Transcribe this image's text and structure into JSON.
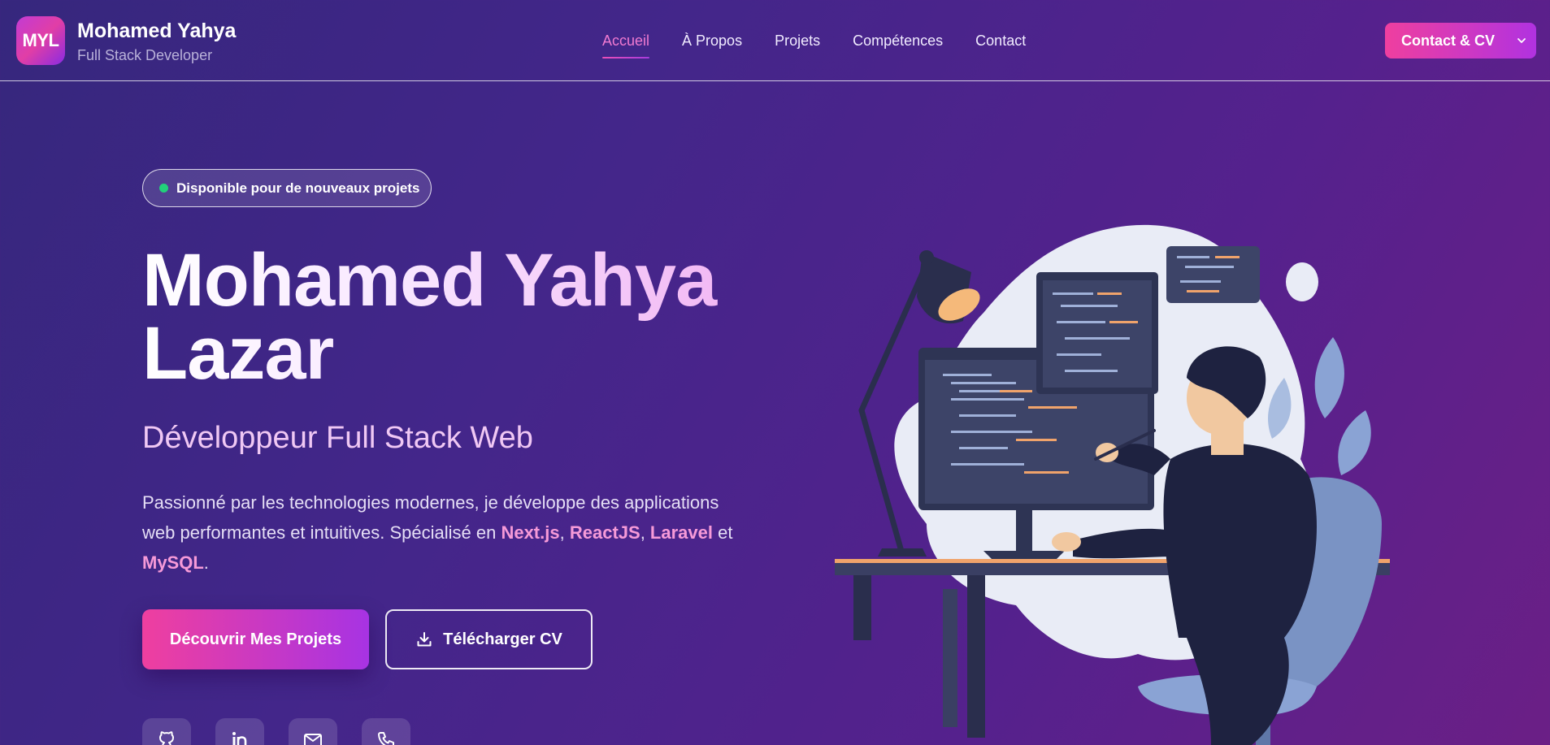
{
  "brand": {
    "logo_text": "MYL",
    "name": "Mohamed Yahya",
    "subtitle": "Full Stack Developer"
  },
  "nav": {
    "items": [
      {
        "label": "Accueil",
        "active": true
      },
      {
        "label": "À Propos",
        "active": false
      },
      {
        "label": "Projets",
        "active": false
      },
      {
        "label": "Compétences",
        "active": false
      },
      {
        "label": "Contact",
        "active": false
      }
    ]
  },
  "header": {
    "contact_button": "Contact & CV",
    "contact_icon": "chevron-down-icon"
  },
  "hero": {
    "availability": "Disponible pour de nouveaux projets",
    "title_line1": "Mohamed Yahya",
    "title_line2": "Lazar",
    "subtitle": "Développeur Full Stack Web",
    "description": {
      "intro": "Passionné par les technologies modernes, je développe des applications web performantes et intuitives. Spécialisé en ",
      "tech1": "Next.js",
      "sep1": ", ",
      "tech2": "ReactJS",
      "sep2": ", ",
      "tech3": "Laravel",
      "sep3": " et ",
      "tech4": "MySQL",
      "end": "."
    },
    "primary_button": "Découvrir Mes Projets",
    "secondary_button": "Télécharger CV"
  },
  "socials": [
    "github-icon",
    "linkedin-icon",
    "mail-icon",
    "phone-icon"
  ],
  "colors": {
    "accent_pink": "#ef3f9f",
    "accent_purple": "#a733e3",
    "available_green": "#22d17a",
    "background": "#43268a"
  }
}
